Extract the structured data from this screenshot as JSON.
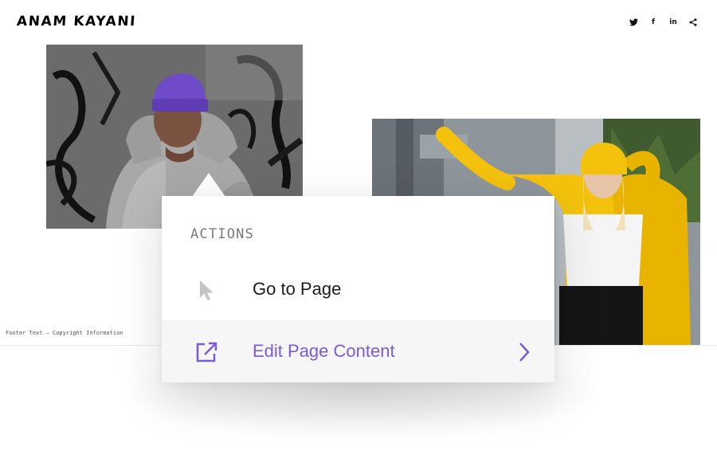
{
  "header": {
    "logo": "ANAM KAYANI",
    "social": [
      {
        "icon": "twitter-icon",
        "glyph": "t"
      },
      {
        "icon": "facebook-icon",
        "glyph": "f"
      },
      {
        "icon": "linkedin-icon",
        "glyph": "in"
      },
      {
        "icon": "share-icon",
        "glyph": ""
      }
    ]
  },
  "gallery": {
    "left_photo": {
      "subject": "person in purple beanie and grey hoodie against graffiti wall"
    },
    "right_photo": {
      "subject": "person in yellow beanie and yellow jacket"
    }
  },
  "footer": {
    "text": "Footer Text — Copyright Information"
  },
  "popover": {
    "heading": "ACTIONS",
    "items": [
      {
        "label": "Go to Page",
        "icon": "cursor-icon"
      },
      {
        "label": "Edit Page Content",
        "icon": "external-link-icon",
        "trailing_icon": "chevron-right-icon"
      }
    ]
  },
  "colors": {
    "accent": "#7b5bd6",
    "muted_text": "#7a7a7a",
    "hover_bg": "#f6f6f7",
    "purple_beanie": "#6f4bc9",
    "yellow_jacket": "#f4c20d"
  }
}
